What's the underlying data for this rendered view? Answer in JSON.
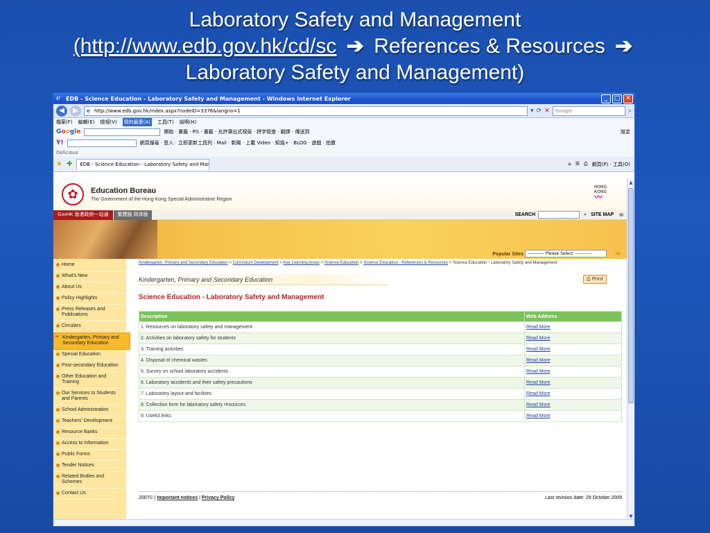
{
  "slide": {
    "title_line1": "Laboratory Safety and Management",
    "url": "(http://www.edb.gov.hk/cd/sc",
    "arrow1": "➔",
    "crumb1": "References & Resources",
    "arrow2": "➔",
    "title_line3": "Laboratory Safety and Management)"
  },
  "window": {
    "title": "EDB - Science Education - Laboratory Safety and Management - Windows Internet Explorer",
    "address": "http://www.edb.gov.hk/index.aspx?nodeID=3376&langno=1",
    "search_placeholder": "Google",
    "menu": [
      "檔案(F)",
      "編輯(E)",
      "檢視(V)",
      "我的最愛(A)",
      "工具(T)",
      "說明(H)"
    ],
    "google_label": "Google",
    "google_tools": "開始 · 書籤 · RS · 書籤 · 允許彈出式視窗 · 拼字檢查 · 翻譯 · 傳送到",
    "settings": "設定",
    "yahoo_tools": "網頁搜尋 · 登入 · 立即更新工具列 · Mail · 新聞 · 上載 Video · 知識+ · BLOG · 遊戲 · 拍賣",
    "delicious": "Delicious",
    "tab_title": "EDB - Science Education - Laboratory Safety and Man...",
    "tab_tools": "網頁(P) · 工具(O)"
  },
  "edb": {
    "name": "Education Bureau",
    "subtitle": "The Government of the Hong Kong Special Administrative Region",
    "brand": "HONG KONG",
    "govhk": "GovHK 香港政府一站通",
    "lang": "繁體版  简体版",
    "search_label": "SEARCH",
    "sitemap": "SITE MAP",
    "popular_label": "Popular Sites",
    "popular_select": "----------- Please Select -----------"
  },
  "nav": [
    "Home",
    "What's New",
    "About Us",
    "Policy Highlights",
    "Press Releases and Publications",
    "Circulars",
    "Kindergarten, Primary and Secondary Education",
    "Special Education",
    "Post-secondary Education",
    "Other Education and Training",
    "Our Services to Students and Parents",
    "School Administration",
    "Teachers' Development",
    "Resource Banks",
    "Access to Information",
    "Public Forms",
    "Tender Notices",
    "Related Bodies and Schemes",
    "Contact Us"
  ],
  "breadcrumb": {
    "items": [
      "Kindergarten, Primary and Secondary Education",
      "Curriculum Development",
      "Key Learning Areas",
      "Science Education",
      "Science Education - References & Resources"
    ],
    "current": "Science Education - Laboratory Safety and Management"
  },
  "section_tag": "Kindergarten, Primary and Secondary Education",
  "print": "Print",
  "heading": "Science Education - Laboratory Safety and Management",
  "table": {
    "headers": [
      "Description",
      "Web Address"
    ],
    "rows": [
      "1. Resources on laboratory safety and management",
      "2. Activities on laboratory safety for students",
      "3. Training activities",
      "4. Disposal of chemical wastes",
      "5. Survey on school laboratory accidents",
      "6. Laboratory accidents and their safety precautions",
      "7. Laboratory layout and facilities",
      "8. Collection form for laboratory safety resources",
      "9. Useful links"
    ],
    "link_label": "Read More"
  },
  "footer": {
    "copyright": "2007©",
    "important": "Important notices",
    "privacy": "Privacy Policy",
    "revision": "Last revision date: 29 October 2009"
  }
}
